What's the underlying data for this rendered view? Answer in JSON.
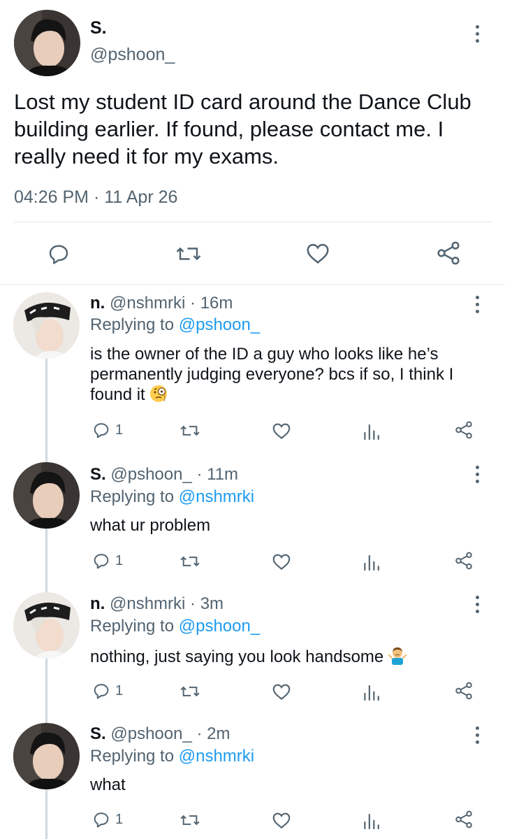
{
  "main_tweet": {
    "display_name": "S.",
    "handle": "@pshoon_",
    "text": "Lost my student ID card around the Dance Club building earlier. If found, please contact me. I really need it for my exams.",
    "timestamp": "04:26 PM · 11 Apr 26"
  },
  "replies": [
    {
      "display_name": "n.",
      "handle": "@nshmrki",
      "age": "· 16m",
      "replying_prefix": "Replying to ",
      "replying_to": "@pshoon_",
      "text": "is the owner of the ID a guy who looks like he’s permanently judging everyone? bcs if so, I think I found it",
      "emoji": "monocle-face",
      "reply_count": "1"
    },
    {
      "display_name": "S.",
      "handle": "@pshoon_",
      "age": "· 11m",
      "replying_prefix": "Replying to ",
      "replying_to": "@nshmrki",
      "text": "what ur problem",
      "reply_count": "1"
    },
    {
      "display_name": "n.",
      "handle": "@nshmrki",
      "age": "· 3m",
      "replying_prefix": "Replying to ",
      "replying_to": "@pshoon_",
      "text": "nothing, just saying you look handsome",
      "emoji": "man-shrugging",
      "reply_count": "1"
    },
    {
      "display_name": "S.",
      "handle": "@pshoon_",
      "age": "· 2m",
      "replying_prefix": "Replying to ",
      "replying_to": "@nshmrki",
      "text": "what",
      "reply_count": "1"
    }
  ],
  "colors": {
    "text": "#0f1419",
    "secondary": "#536471",
    "link": "#1d9bf0",
    "divider": "#e1e8ed",
    "thread_line": "#cfd9de"
  },
  "icons": [
    "more-options-icon",
    "reply-icon",
    "retweet-icon",
    "like-icon",
    "share-icon",
    "views-icon"
  ]
}
